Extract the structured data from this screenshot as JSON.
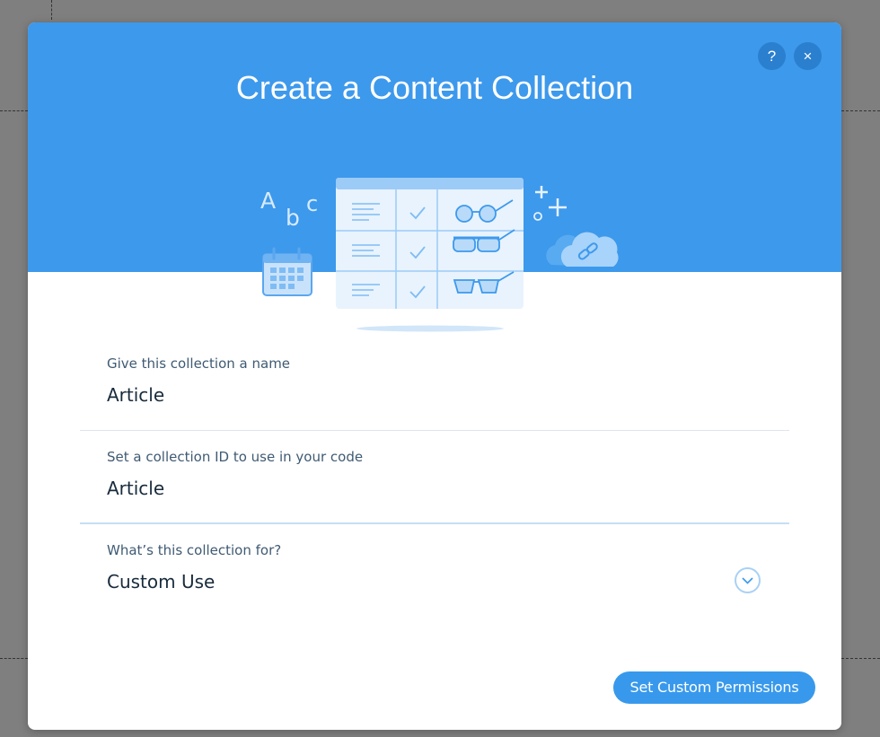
{
  "dialog": {
    "title": "Create a Content Collection",
    "help_label": "?",
    "close_label": "×"
  },
  "illustration": {
    "letters": [
      "A",
      "b",
      "c"
    ],
    "icons": [
      "calendar-icon",
      "table-icon",
      "checkmark-icon",
      "glasses-icon",
      "cloud-link-icon",
      "plus-icon"
    ]
  },
  "fields": {
    "name": {
      "label": "Give this collection a name",
      "value": "Article"
    },
    "id": {
      "label": "Set a collection ID to use in your code",
      "value": "Article"
    },
    "purpose": {
      "label": "What’s this collection for?",
      "value": "Custom Use"
    }
  },
  "footer": {
    "primary_label": "Set Custom Permissions"
  },
  "colors": {
    "header": "#3d99ec",
    "accent": "#3899ec",
    "overlay": "#7f7f7f"
  }
}
